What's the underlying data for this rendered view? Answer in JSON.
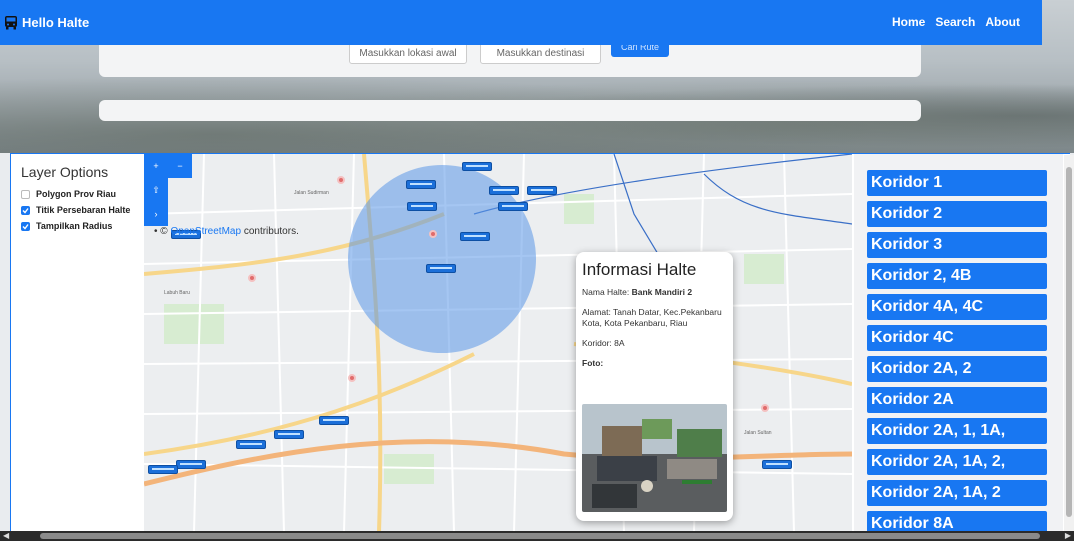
{
  "navbar": {
    "brand": "Hello Halte",
    "links": [
      "Home",
      "Search",
      "About"
    ],
    "color": "#1877f2"
  },
  "hero": {
    "origin_placeholder": "Masukkan lokasi awal",
    "destination_placeholder": "Masukkan destinasi",
    "search_label": "Cari Rute"
  },
  "layer_options": {
    "title": "Layer Options",
    "items": [
      {
        "label": "Polygon Prov Riau",
        "checked": false
      },
      {
        "label": "Titik Persebaran Halte",
        "checked": true
      },
      {
        "label": "Tampilkan Radius",
        "checked": true
      }
    ]
  },
  "map": {
    "zoom_in": "+",
    "zoom_out": "−",
    "locate": "⇧",
    "expand": "›",
    "attribution_prefix": "• ©",
    "attribution_link": "OpenStreetMap",
    "attribution_suffix": " contributors."
  },
  "popup": {
    "title": "Informasi Halte",
    "nama_label": "Nama Halte: ",
    "nama_value": "Bank Mandiri 2",
    "alamat_label": "Alamat: ",
    "alamat_value": "Tanah Datar, Kec.Pekanbaru Kota, Kota Pekanbaru, Riau",
    "koridor_label": "Koridor: ",
    "koridor_value": "8A",
    "foto_label": "Foto:"
  },
  "corridors": [
    "Koridor 1",
    "Koridor 2",
    "Koridor 3",
    "Koridor 2, 4B",
    "Koridor 4A, 4C",
    "Koridor 4C",
    "Koridor 2A, 2",
    "Koridor 2A",
    "Koridor 2A, 1, 1A,",
    "Koridor 2A, 1A, 2,",
    "Koridor 2A, 1A, 2",
    "Koridor 8A"
  ]
}
